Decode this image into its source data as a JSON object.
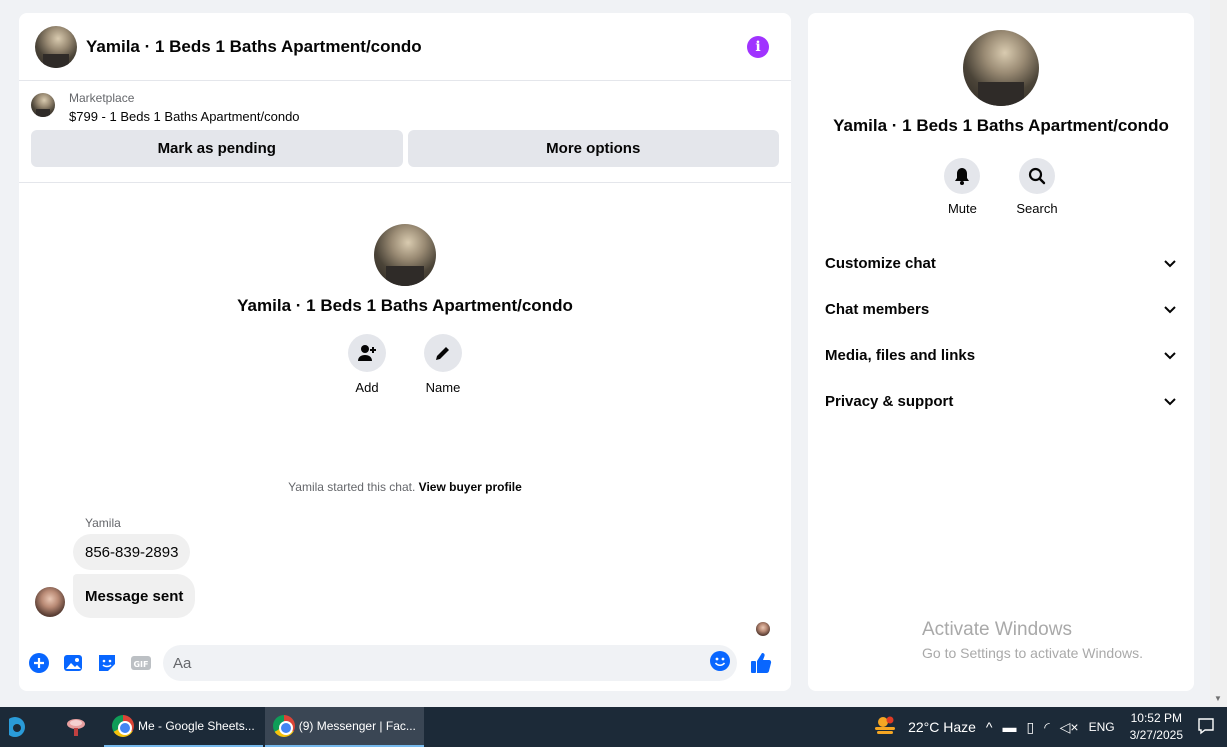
{
  "chat": {
    "title": "Yamila · 1 Beds 1 Baths Apartment/condo",
    "marketplace_label": "Marketplace",
    "listing": "$799 - 1 Beds 1 Baths Apartment/condo",
    "mark_pending": "Mark as pending",
    "more_options": "More options",
    "intro_title": "Yamila · 1 Beds 1 Baths Apartment/condo",
    "add_label": "Add",
    "name_label": "Name",
    "started_text": "Yamila started this chat.",
    "buyer_profile_link": "View buyer profile",
    "sender": "Yamila",
    "messages": [
      "856-839-2893",
      "Message sent"
    ],
    "composer_placeholder": "Aa",
    "gif_label": "GIF"
  },
  "info": {
    "title": "Yamila · 1 Beds 1 Baths Apartment/condo",
    "mute_label": "Mute",
    "search_label": "Search",
    "sections": [
      "Customize chat",
      "Chat members",
      "Media, files and links",
      "Privacy & support"
    ]
  },
  "watermark": {
    "line1": "Activate Windows",
    "line2": "Go to Settings to activate Windows."
  },
  "taskbar": {
    "task1": "Me - Google Sheets...",
    "task2": "(9) Messenger | Fac...",
    "weather": "22°C  Haze",
    "lang": "ENG",
    "time": "10:52 PM",
    "date": "3/27/2025"
  },
  "colors": {
    "messenger_blue": "#0866ff",
    "info_purple": "#a033ff",
    "bubble_gray": "#f0f0f0"
  }
}
